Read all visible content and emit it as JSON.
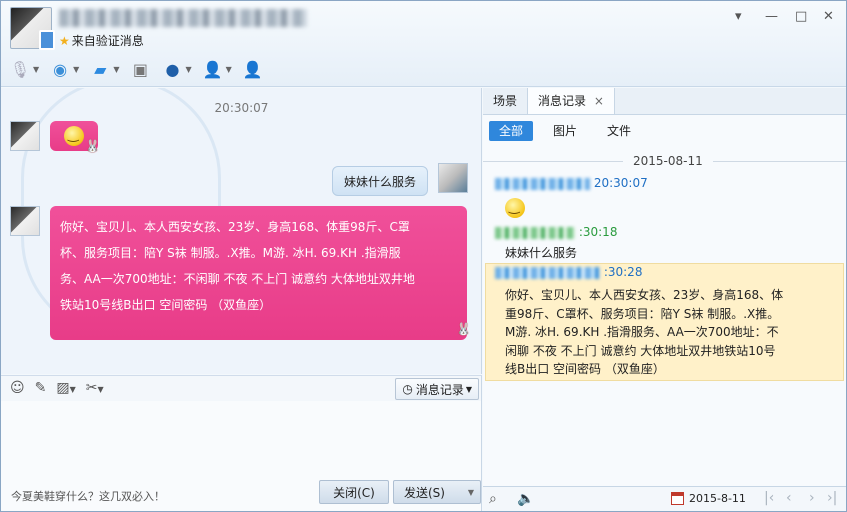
{
  "header": {
    "verify_label": "来自验证消息",
    "controls": [
      "▾",
      "—",
      "□",
      "✕"
    ],
    "toolbar": [
      {
        "icon": "microphone-icon",
        "glyph": "🎙"
      },
      {
        "icon": "video-camera-icon",
        "glyph": "📹"
      },
      {
        "icon": "file-transfer-icon",
        "glyph": "📁"
      },
      {
        "icon": "remote-desktop-icon",
        "glyph": "🖥"
      },
      {
        "icon": "police-icon",
        "glyph": "👮"
      },
      {
        "icon": "remove-contact-icon",
        "glyph": "👤"
      },
      {
        "icon": "add-contact-icon",
        "glyph": "👤"
      }
    ]
  },
  "chat": {
    "timestamp": "20:30:07",
    "messages": {
      "self_reply": "妹妹什么服务",
      "long_line1": "你好、宝贝儿、本人西安女孩、23岁、身高168、体重98斤、C罩",
      "long_line2": "杯、服务项目：陪Y S袜 制服。.X推。M游. 冰H. 69.KH .指滑服",
      "long_line3": "务、AA一次700地址：不闲聊 不夜 不上门 诚意约 大体地址双井地",
      "long_line4": "铁站10号线B出口 空间密码 （双鱼座）"
    }
  },
  "input": {
    "history_button": "消息记录",
    "ad_text": "今夏美鞋穿什么？这几双必入！",
    "close_button": "关闭(C)",
    "send_button": "发送(S)"
  },
  "right": {
    "tabs": [
      "场景",
      "消息记录"
    ],
    "tab_close": "×",
    "filters": [
      "全部",
      "图片",
      "文件"
    ],
    "date": "2015-08-11",
    "records": {
      "r1_time": "20:30:07",
      "r2_time": ":30:18",
      "r2_text": "妹妹什么服务",
      "r3_time": ":30:28",
      "r3_line1": "你好、宝贝儿、本人西安女孩、23岁、身高168、体",
      "r3_line2": "重98斤、C罩杯、服务项目：陪Y S袜 制服。.X推。",
      "r3_line3": "M游. 冰H. 69.KH .指滑服务、AA一次700地址：不",
      "r3_line4": "闲聊 不夜 不上门 诚意约 大体地址双井地铁站10号",
      "r3_line5": "线B出口 空间密码 （双鱼座）"
    },
    "bottom_date": "2015-8-11"
  },
  "colors": {
    "pink_bubble": "#e83c88",
    "accent_blue": "#2f87dc",
    "highlight": "#fff1c9"
  }
}
